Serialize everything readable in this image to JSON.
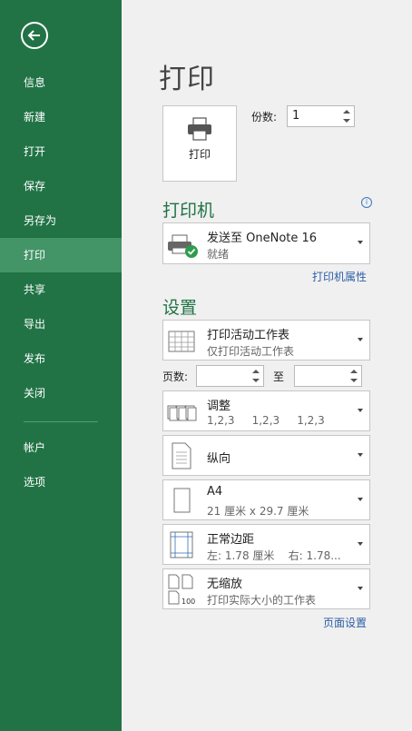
{
  "sidebar": {
    "items": [
      {
        "label": "信息"
      },
      {
        "label": "新建"
      },
      {
        "label": "打开"
      },
      {
        "label": "保存"
      },
      {
        "label": "另存为"
      },
      {
        "label": "打印"
      },
      {
        "label": "共享"
      },
      {
        "label": "导出"
      },
      {
        "label": "发布"
      },
      {
        "label": "关闭"
      },
      {
        "label": "帐户"
      },
      {
        "label": "选项"
      }
    ],
    "active": "打印"
  },
  "main": {
    "title": "打印",
    "print_button": "打印",
    "copies_label": "份数:",
    "copies_value": "1",
    "printer": {
      "heading": "打印机",
      "name": "发送至 OneNote 16",
      "status": "就绪",
      "properties_link": "打印机属性"
    },
    "settings": {
      "heading": "设置",
      "scope": {
        "title": "打印活动工作表",
        "subtitle": "仅打印活动工作表"
      },
      "pages_label": "页数:",
      "pages_from": "",
      "to_label": "至",
      "pages_to": "",
      "collation": {
        "title": "调整",
        "subtitle": "1,2,3     1,2,3     1,2,3"
      },
      "orientation": {
        "title": "纵向"
      },
      "paper": {
        "title": "A4",
        "subtitle": "21 厘米 x 29.7 厘米"
      },
      "margins": {
        "title": "正常边距",
        "subtitle": "左: 1.78 厘米    右: 1.78..."
      },
      "scaling": {
        "title": "无缩放",
        "subtitle": "打印实际大小的工作表"
      },
      "page_setup_link": "页面设置"
    }
  },
  "colors": {
    "sidebar": "#217346",
    "active": "#439467",
    "accent": "#217346",
    "link": "#2c5ea8"
  }
}
